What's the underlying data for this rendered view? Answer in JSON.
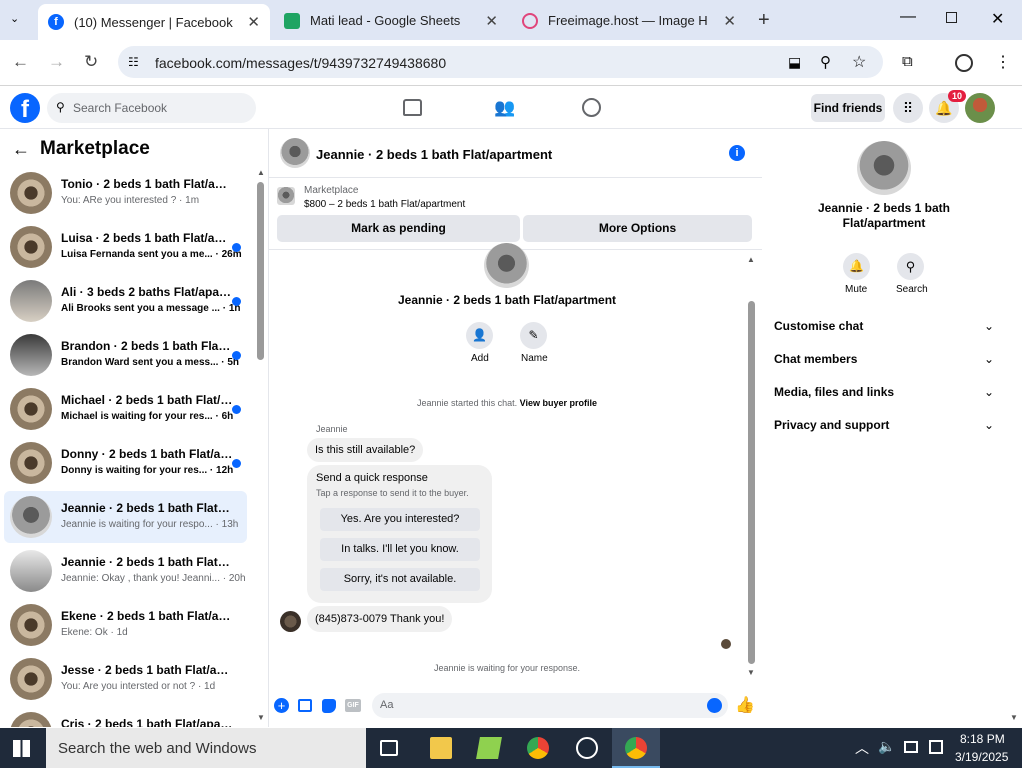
{
  "browser": {
    "tabs": [
      {
        "title": "(10) Messenger | Facebook"
      },
      {
        "title": "Mati lead - Google Sheets"
      },
      {
        "title": "Freeimage.host — Image Hosti"
      }
    ],
    "url": "facebook.com/messages/t/9439732749438680"
  },
  "fb_header": {
    "search_placeholder": "Search Facebook",
    "find_friends": "Find friends",
    "notification_count": "10",
    "brand_color": "#0866ff"
  },
  "sidebar": {
    "title": "Marketplace",
    "conversations": [
      {
        "name": "Tonio · 2 beds 1 bath Flat/apart...",
        "preview": "You: ARe you interested ? · 1m",
        "unread": false
      },
      {
        "name": "Luisa · 2 beds 1 bath Flat/apar...",
        "preview": "Luisa Fernanda sent you a me... · 26m",
        "unread": true
      },
      {
        "name": "Ali · 3 beds 2 baths Flat/apart...",
        "preview": "Ali Brooks sent you a message ... · 1h",
        "unread": true
      },
      {
        "name": "Brandon · 2 beds 1 bath Flat/a...",
        "preview": "Brandon Ward sent you a mess... · 5h",
        "unread": true
      },
      {
        "name": "Michael · 2 beds 1 bath Flat/a...",
        "preview": "Michael is waiting for your res... · 6h",
        "unread": true
      },
      {
        "name": "Donny · 2 beds 1 bath Flat/ap...",
        "preview": "Donny is waiting for your res... · 12h",
        "unread": true
      },
      {
        "name": "Jeannie · 2 beds 1 bath Flat/apa...",
        "preview": "Jeannie is waiting for your respo... · 13h",
        "unread": false
      },
      {
        "name": "Jeannie · 2 beds 1 bath Flat/apa...",
        "preview": "Jeannie: Okay , thank you! Jeanni... · 20h",
        "unread": false
      },
      {
        "name": "Ekene · 2 beds 1 bath Flat/apart...",
        "preview": "Ekene: Ok · 1d",
        "unread": false
      },
      {
        "name": "Jesse · 2 beds 1 bath Flat/apart...",
        "preview": "You: Are you intersted or not ? · 1d",
        "unread": false
      },
      {
        "name": "Cris · 2 beds 1 bath Flat/apartm...",
        "preview": "",
        "unread": false
      }
    ]
  },
  "chat": {
    "header_title": "Jeannie · 2 beds 1 bath Flat/apartment",
    "listing_label": "Marketplace",
    "listing_price": "$800 – 2 beds 1 bath Flat/apartment",
    "mark_pending": "Mark as pending",
    "more_options": "More Options",
    "profile_name": "Jeannie · 2 beds 1 bath Flat/apartment",
    "add_label": "Add",
    "name_label": "Name",
    "started_text": "Jeannie started this chat.",
    "view_buyer": "View buyer profile",
    "sender": "Jeannie",
    "msg1": "Is this still available?",
    "quick_title": "Send a quick response",
    "quick_sub": "Tap a response to send it to the buyer.",
    "quick_responses": [
      "Yes. Are you interested?",
      "In talks. I'll let you know.",
      "Sorry, it's not available."
    ],
    "msg2": "(845)873-0079 Thank you!",
    "waiting": "Jeannie is waiting for your response.",
    "input_placeholder": "Aa"
  },
  "right_panel": {
    "name": "Jeannie · 2 beds 1 bath Flat/apartment",
    "mute": "Mute",
    "search": "Search",
    "rows": [
      "Customise chat",
      "Chat members",
      "Media, files and links",
      "Privacy and support"
    ]
  },
  "taskbar": {
    "search": "Search the web and Windows",
    "time": "8:18 PM",
    "date": "3/19/2025"
  }
}
